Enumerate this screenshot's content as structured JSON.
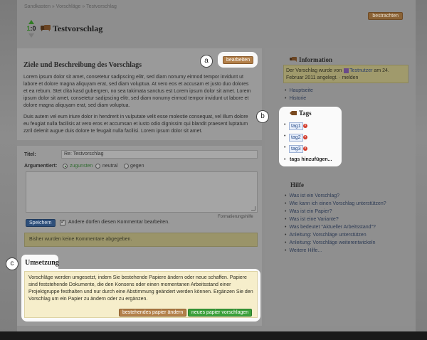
{
  "breadcrumb": [
    "Sandkasten",
    "Vorschläge",
    "Testvorschlag"
  ],
  "breadcrumb_sep": " » ",
  "login_label": "bestrachten",
  "vote": {
    "score": "1:0",
    "pro": "1",
    "contra": "0"
  },
  "title": "Testvorschlag",
  "goals": {
    "heading": "Ziele und Beschreibung des Vorschlags",
    "edit_label": "bearbeiten",
    "p1": "Lorem ipsum dolor sit amet, consetetur sadipscing elitr, sed diam nonumy eirmod tempor invidunt ut labore et dolore magna aliquyam erat, sed diam voluptua. At vero eos et accusam et justo duo dolores et ea rebum. Stet clita kasd gubergren, no sea takimata sanctus est Lorem ipsum dolor sit amet. Lorem ipsum dolor sit amet, consetetur sadipscing elitr, sed diam nonumy eirmod tempor invidunt ut labore et dolore magna aliquyam erat, sed diam voluptua.",
    "p2": "Duis autem vel eum iriure dolor in hendrerit in vulputate velit esse molestie consequat, vel illum dolore eu feugiat nulla facilisis at vero eros et accumsan et iusto odio dignissim qui blandit praesent luptatum zzril delenit augue duis dolore te feugait nulla facilisi. Lorem ipsum dolor sit amet."
  },
  "callouts": {
    "a": "a",
    "b": "b",
    "c": "c"
  },
  "comment_form": {
    "title_label": "Titel:",
    "title_value": "Re: Testvorschlag",
    "argument_label": "Argumentiert:",
    "options": {
      "pro": "zugunsten",
      "neutral": "neutral",
      "contra": "gegen"
    },
    "selected": "pro",
    "format_help": "Formatierungshilfe",
    "save_label": "Speichern",
    "allow_edit_label": "Andere dürfen diesen Kommentar bearbeiten.",
    "allow_edit_checked": true
  },
  "no_comments": "Bisher wurden keine Kommentare abgegeben.",
  "umsetzung": {
    "heading": "Umsetzung",
    "text": "Vorschläge werden umgesetzt, indem Sie bestehende Papiere ändern oder neue schaffen. Papiere sind feststehende Dokumente, die den Konsens oder einen momentanen Arbeitsstand einer Projektgruppe festhalten und nur durch eine Abstimmung geändert werden können. Ergänzen Sie den Vorschlag um ein Papier zu ändern oder zu ergänzen.",
    "existing_label": "bestehendes papier ändern",
    "new_label": "neues papier vorschlagen"
  },
  "sidebar": {
    "info_heading": "Information",
    "info_before": "Der Vorschlag wurde von",
    "info_user": "Testnutzer",
    "info_after": "am 24. Februar 2011 angelegt. · melden",
    "page_links": [
      "Hauptseite",
      "Historie"
    ],
    "tags_heading": "Tags",
    "tags": [
      "tag1",
      "tag2",
      "tag3"
    ],
    "tag_delete_symbol": "×",
    "add_tags_label": "tags hinzufügen...",
    "help_heading": "Hilfe",
    "help_links": [
      "Was ist ein Vorschlag?",
      "Wie kann ich einen Vorschlag unterstützen?",
      "Was ist ein Papier?",
      "Was ist eine Variante?",
      "Was bedeutet \"Aktueller Arbeitsstand\"?",
      "Anleitung: Vorschläge unterstützen",
      "Anleitung: Vorschläge weiterentwickeln",
      "Weitere Hilfe..."
    ]
  },
  "colors": {
    "brand_brown": "#b3804a",
    "action_green": "#3aa03a",
    "save_blue": "#2e4f7a",
    "info_yellow": "#f6eecb"
  },
  "icons": {
    "title": "speech-bubbles-icon",
    "info": "speech-bubbles-icon",
    "tags": "tag-icon",
    "vote_up": "arrow-up-icon",
    "vote_down": "arrow-down-icon"
  }
}
